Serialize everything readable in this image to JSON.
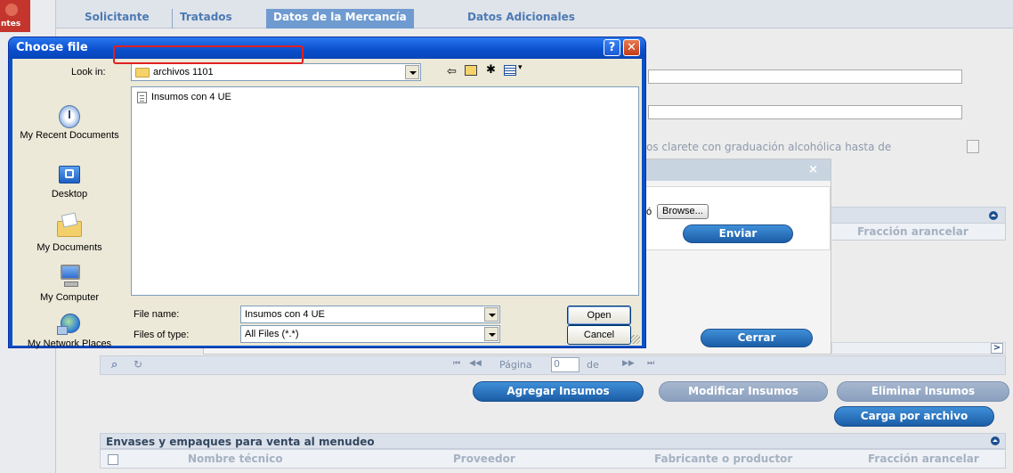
{
  "background_app": {
    "logo_text": "ntes",
    "tabs": [
      "Solicitante",
      "Tratados",
      "Datos de la Mercancía",
      "Datos Adicionales"
    ],
    "description_fragment": "os clarete con graduación alcohólica hasta de",
    "upload_dialog": {
      "close_glyph": "×",
      "file_field_fragment": "ció",
      "browse_label": "Browse...",
      "send_label": "Enviar",
      "close_label": "Cerrar"
    },
    "grid_header_fraccion": "Fracción arancelar",
    "pager": {
      "page_label": "Página",
      "page_value": "0",
      "of_label": "de"
    },
    "buttons": {
      "add": "Agregar Insumos",
      "modify": "Modificar Insumos",
      "delete": "Eliminar Insumos",
      "upload_file": "Carga por archivo"
    },
    "packaging_panel": {
      "title": "Envases y empaques para venta al menudeo",
      "columns": [
        "Nombre técnico",
        "Proveedor",
        "Fabricante o productor",
        "Fracción arancelar"
      ]
    }
  },
  "file_dialog": {
    "title": "Choose file",
    "help_glyph": "?",
    "close_glyph": "✕",
    "look_in_label": "Look in:",
    "look_in_value": "archivos 1101",
    "places": [
      {
        "label": "My Recent Documents",
        "icon": "recent-documents-icon"
      },
      {
        "label": "Desktop",
        "icon": "desktop-icon"
      },
      {
        "label": "My Documents",
        "icon": "my-documents-icon"
      },
      {
        "label": "My Computer",
        "icon": "my-computer-icon"
      },
      {
        "label": "My Network Places",
        "icon": "network-places-icon"
      }
    ],
    "files": [
      "Insumos con 4 UE"
    ],
    "file_name_label": "File name:",
    "file_name_value": "Insumos con 4 UE",
    "file_type_label": "Files of type:",
    "file_type_value": "All Files (*.*)",
    "open_label": "Open",
    "cancel_label": "Cancel"
  },
  "colors": {
    "xp_title_blue": "#0a4ecb",
    "highlight_red": "#e02020",
    "app_button_blue": "#1c5da7",
    "tab_active": "#6f9bd1"
  }
}
